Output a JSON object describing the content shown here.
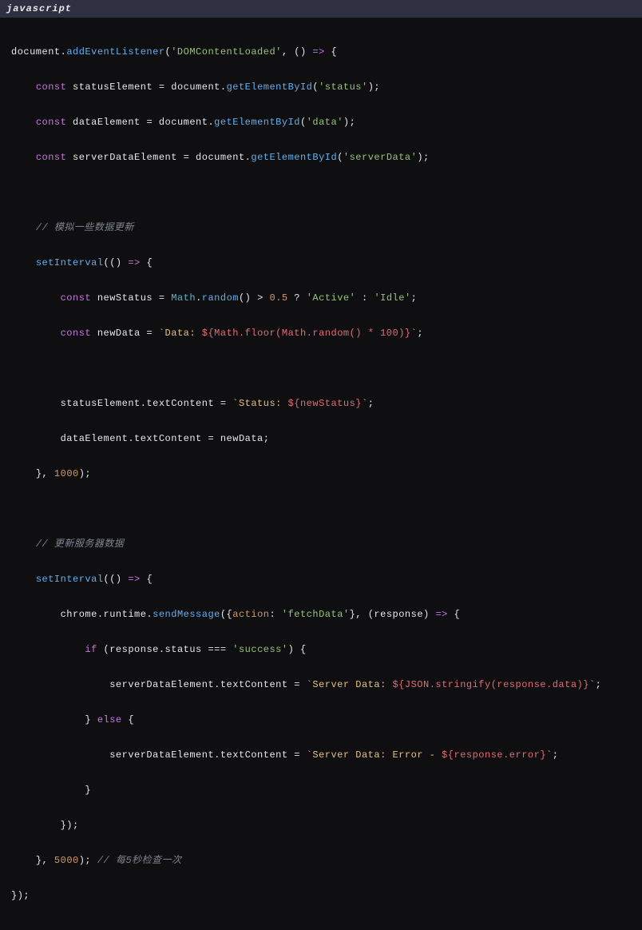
{
  "header": {
    "language": "javascript"
  },
  "code": {
    "l1": {
      "a": "document.",
      "b": "addEventListener",
      "c": "(",
      "d": "'DOMContentLoaded'",
      "e": ", () ",
      "f": "=>",
      "g": " {"
    },
    "l2": {
      "a": "const",
      "b": " statusElement = document.",
      "c": "getElementById",
      "d": "(",
      "e": "'status'",
      "f": ");"
    },
    "l3": {
      "a": "const",
      "b": " dataElement = document.",
      "c": "getElementById",
      "d": "(",
      "e": "'data'",
      "f": ");"
    },
    "l4": {
      "a": "const",
      "b": " serverDataElement = document.",
      "c": "getElementById",
      "d": "(",
      "e": "'serverData'",
      "f": ");"
    },
    "l5": {
      "a": "// 模拟一些数据更新"
    },
    "l6": {
      "a": "setInterval",
      "b": "(() ",
      "c": "=>",
      "d": " {"
    },
    "l7": {
      "a": "const",
      "b": " newStatus = ",
      "c": "Math",
      "d": ".",
      "e": "random",
      "f": "() > ",
      "g": "0.5",
      "h": " ? ",
      "i": "'Active'",
      "j": " : ",
      "k": "'Idle'",
      "l": ";"
    },
    "l8": {
      "a": "const",
      "b": " newData = ",
      "c": "`Data: ",
      "d": "${Math.floor(Math.random() * 100)}",
      "e": "`",
      "f": ";"
    },
    "l9": {
      "a": "statusElement.textContent = ",
      "b": "`Status: ",
      "c": "${newStatus}",
      "d": "`",
      "e": ";"
    },
    "l10": {
      "a": "dataElement.textContent = newData;"
    },
    "l11": {
      "a": "}, ",
      "b": "1000",
      "c": ");"
    },
    "l12": {
      "a": "// 更新服务器数据"
    },
    "l13": {
      "a": "setInterval",
      "b": "(() ",
      "c": "=>",
      "d": " {"
    },
    "l14": {
      "a": "chrome.runtime.",
      "b": "sendMessage",
      "c": "({",
      "d": "action",
      "e": ": ",
      "f": "'fetchData'",
      "g": "}, (response) ",
      "h": "=>",
      "i": " {"
    },
    "l15": {
      "a": "if",
      "b": " (response.status === ",
      "c": "'success'",
      "d": ") {"
    },
    "l16": {
      "a": "serverDataElement.textContent = ",
      "b": "`Server Data: ",
      "c": "${JSON.stringify(response.data)}",
      "d": "`",
      "e": ";"
    },
    "l17": {
      "a": "} ",
      "b": "else",
      "c": " {"
    },
    "l18": {
      "a": "serverDataElement.textContent = ",
      "b": "`Server Data: Error - ",
      "c": "${response.error}",
      "d": "`",
      "e": ";"
    },
    "l19": {
      "a": "}"
    },
    "l20": {
      "a": "});"
    },
    "l21": {
      "a": "}, ",
      "b": "5000",
      "c": "); ",
      "d": "// 每5秒检查一次"
    },
    "l22": {
      "a": "});"
    }
  }
}
